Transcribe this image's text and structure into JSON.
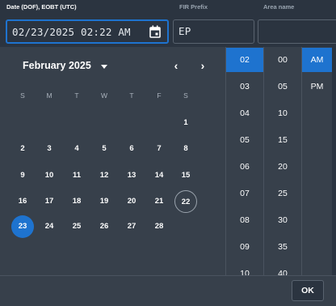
{
  "fields": {
    "date_label": "Date (DOF), EOBT (UTC)",
    "date_value": "02/23/2025 02:22 AM",
    "fir_label": "FIR Prefix",
    "fir_value": "EP",
    "area_label": "Area name",
    "area_value": ""
  },
  "calendar": {
    "month_label": "February 2025",
    "prev_label": "‹",
    "next_label": "›",
    "weekdays": [
      "S",
      "M",
      "T",
      "W",
      "T",
      "F",
      "S"
    ],
    "weeks": [
      [
        "",
        "",
        "",
        "",
        "",
        "",
        "1"
      ],
      [
        "2",
        "3",
        "4",
        "5",
        "6",
        "7",
        "8"
      ],
      [
        "9",
        "10",
        "11",
        "12",
        "13",
        "14",
        "15"
      ],
      [
        "16",
        "17",
        "18",
        "19",
        "20",
        "21",
        "22"
      ],
      [
        "23",
        "24",
        "25",
        "26",
        "27",
        "28",
        ""
      ]
    ],
    "today": "22",
    "selected": "23"
  },
  "time": {
    "hours": [
      "02",
      "03",
      "04",
      "05",
      "06",
      "07",
      "08",
      "09",
      "10"
    ],
    "selected_hour": "02",
    "minutes": [
      "00",
      "05",
      "10",
      "15",
      "20",
      "25",
      "30",
      "35",
      "40"
    ],
    "ampm": [
      "AM",
      "PM"
    ],
    "selected_ampm": "AM"
  },
  "footer": {
    "ok_label": "OK"
  },
  "colors": {
    "accent": "#1e73cf",
    "panel": "#37404b",
    "topbar": "#2b3440"
  },
  "icons": {
    "date_field": "calendar-icon",
    "month_dropdown": "caret-down-icon",
    "prev": "chevron-left-icon",
    "next": "chevron-right-icon"
  }
}
